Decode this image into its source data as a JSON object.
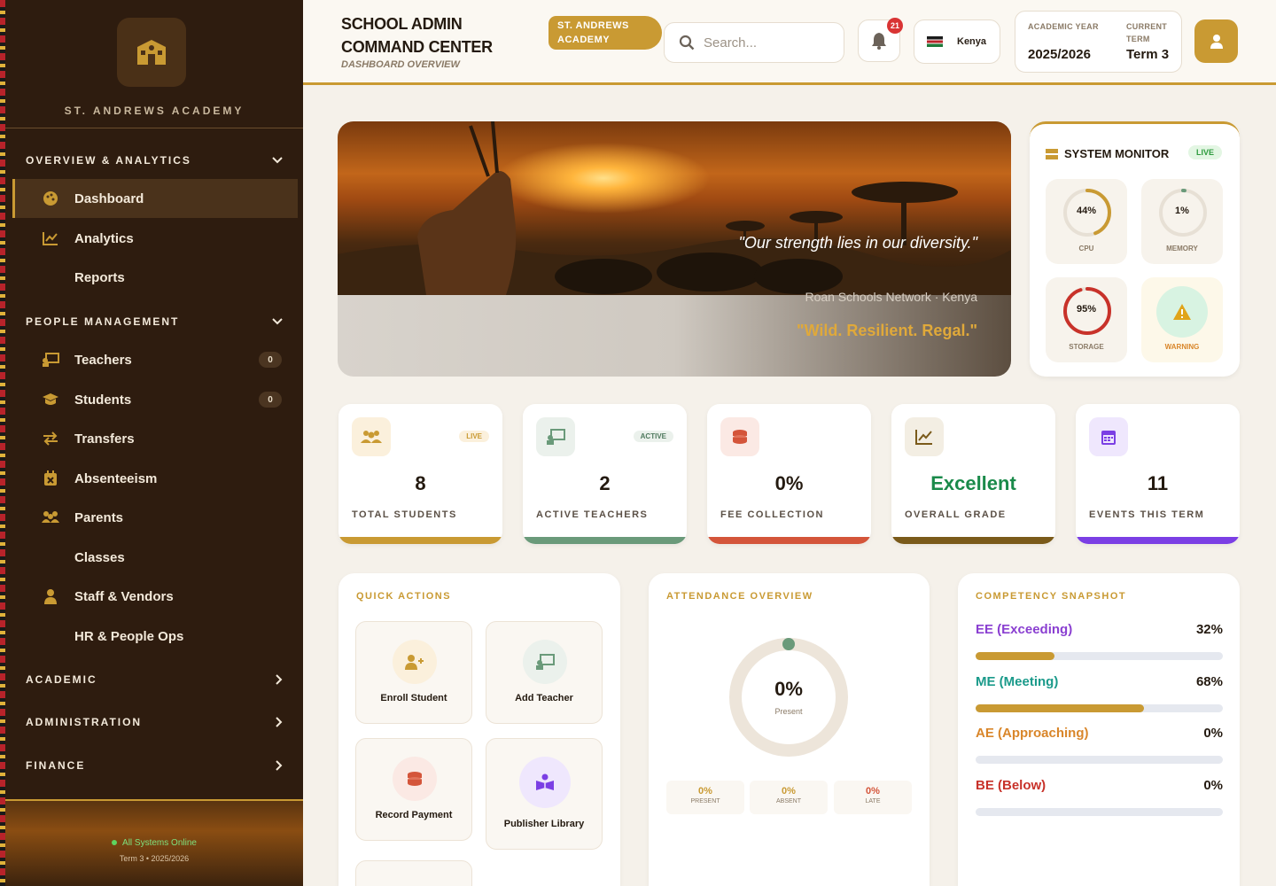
{
  "sidebar": {
    "brand": "ST. ANDREWS ACADEMY",
    "sections": {
      "overview": "OVERVIEW & ANALYTICS",
      "people": "PEOPLE MANAGEMENT",
      "academic": "ACADEMIC",
      "administration": "ADMINISTRATION",
      "finance": "FINANCE"
    },
    "items": [
      {
        "label": "Dashboard"
      },
      {
        "label": "Analytics"
      },
      {
        "label": "Reports"
      },
      {
        "label": "Teachers",
        "count": "0"
      },
      {
        "label": "Students",
        "count": "0"
      },
      {
        "label": "Transfers"
      },
      {
        "label": "Absenteeism"
      },
      {
        "label": "Parents"
      },
      {
        "label": "Classes"
      },
      {
        "label": "Staff & Vendors"
      },
      {
        "label": "HR & People Ops"
      }
    ],
    "footer": {
      "status": "All Systems Online",
      "term": "Term 3 • 2025/2026"
    }
  },
  "header": {
    "title": "SCHOOL ADMIN COMMAND CENTER",
    "subtitle": "DASHBOARD OVERVIEW",
    "school_pill": "ST. ANDREWS ACADEMY",
    "search_placeholder": "Search...",
    "notifications": "21",
    "country": "Kenya",
    "academic_year_label": "ACADEMIC YEAR",
    "academic_year": "2025/2026",
    "current_term_label": "CURRENT TERM",
    "current_term": "Term 3"
  },
  "hero": {
    "quote": "\"Our strength lies in our diversity.\"",
    "source": "Roan Schools Network · Kenya",
    "motto": "\"Wild. Resilient. Regal.\""
  },
  "monitor": {
    "title": "SYSTEM MONITOR",
    "live": "LIVE",
    "cpu": {
      "value": "44%",
      "label": "CPU",
      "percent": 44
    },
    "memory": {
      "value": "1%",
      "label": "MEMORY",
      "percent": 1
    },
    "storage": {
      "value": "95%",
      "label": "STORAGE",
      "percent": 95
    },
    "warning": {
      "label": "WARNING"
    }
  },
  "stats": [
    {
      "value": "8",
      "label": "TOTAL STUDENTS",
      "tag": "LIVE",
      "color": "#c99a33"
    },
    {
      "value": "2",
      "label": "ACTIVE TEACHERS",
      "tag": "ACTIVE",
      "color": "#6a9a7a"
    },
    {
      "value": "0%",
      "label": "FEE COLLECTION",
      "color": "#d4553a"
    },
    {
      "value": "Excellent",
      "label": "OVERALL GRADE",
      "color": "#7a5a1a"
    },
    {
      "value": "11",
      "label": "EVENTS THIS TERM",
      "color": "#7b3fe4"
    }
  ],
  "quick_actions": {
    "title": "QUICK ACTIONS",
    "items": [
      "Enroll Student",
      "Add Teacher",
      "Record Payment",
      "Publisher Library"
    ]
  },
  "attendance": {
    "title": "ATTENDANCE OVERVIEW",
    "value": "0%",
    "value_label": "Present",
    "present": {
      "value": "0%",
      "label": "PRESENT"
    },
    "absent": {
      "value": "0%",
      "label": "ABSENT"
    },
    "late": {
      "value": "0%",
      "label": "LATE"
    }
  },
  "competency": {
    "title": "COMPETENCY SNAPSHOT",
    "rows": [
      {
        "label": "EE (Exceeding)",
        "value": "32%",
        "percent": 32,
        "color": "#8a3fd1"
      },
      {
        "label": "ME (Meeting)",
        "value": "68%",
        "percent": 68,
        "color": "#1a9a8a"
      },
      {
        "label": "AE (Approaching)",
        "value": "0%",
        "percent": 0,
        "color": "#d9862a"
      },
      {
        "label": "BE (Below)",
        "value": "0%",
        "percent": 0,
        "color": "#c8322a"
      }
    ]
  }
}
